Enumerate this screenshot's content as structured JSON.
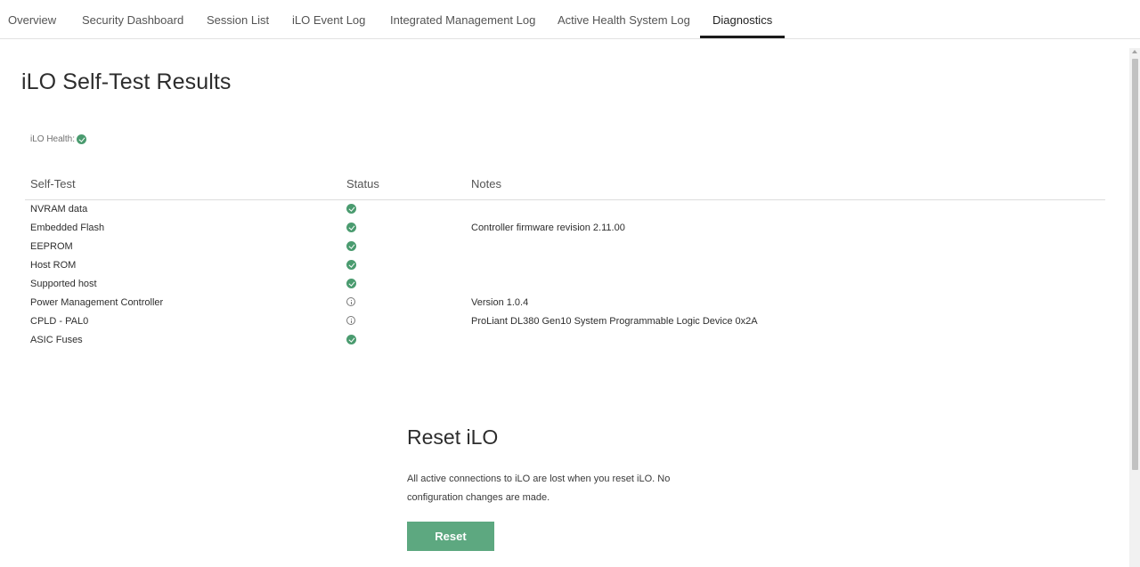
{
  "tabs": [
    {
      "label": "Overview",
      "active": false
    },
    {
      "label": "Security Dashboard",
      "active": false
    },
    {
      "label": "Session List",
      "active": false
    },
    {
      "label": "iLO Event Log",
      "active": false
    },
    {
      "label": "Integrated Management Log",
      "active": false
    },
    {
      "label": "Active Health System Log",
      "active": false
    },
    {
      "label": "Diagnostics",
      "active": true
    }
  ],
  "page_title": "iLO Self-Test Results",
  "health": {
    "label": "iLO Health:",
    "status": "ok",
    "icon": "check-circle-icon"
  },
  "table": {
    "columns": [
      "Self-Test",
      "Status",
      "Notes"
    ],
    "rows": [
      {
        "name": "NVRAM data",
        "status": "ok",
        "notes": ""
      },
      {
        "name": "Embedded Flash",
        "status": "ok",
        "notes": "Controller firmware revision 2.11.00"
      },
      {
        "name": "EEPROM",
        "status": "ok",
        "notes": ""
      },
      {
        "name": "Host ROM",
        "status": "ok",
        "notes": ""
      },
      {
        "name": "Supported host",
        "status": "ok",
        "notes": ""
      },
      {
        "name": "Power Management Controller",
        "status": "info",
        "notes": "Version 1.0.4"
      },
      {
        "name": "CPLD - PAL0",
        "status": "info",
        "notes": "ProLiant DL380 Gen10 System Programmable Logic Device 0x2A"
      },
      {
        "name": "ASIC Fuses",
        "status": "ok",
        "notes": ""
      }
    ]
  },
  "reset": {
    "title": "Reset iLO",
    "description": "All active connections to iLO are lost when you reset iLO. No configuration changes are made.",
    "button_label": "Reset"
  },
  "colors": {
    "ok": "#4a9b6f",
    "button": "#5da880",
    "active_tab_underline": "#1a1a1a"
  }
}
